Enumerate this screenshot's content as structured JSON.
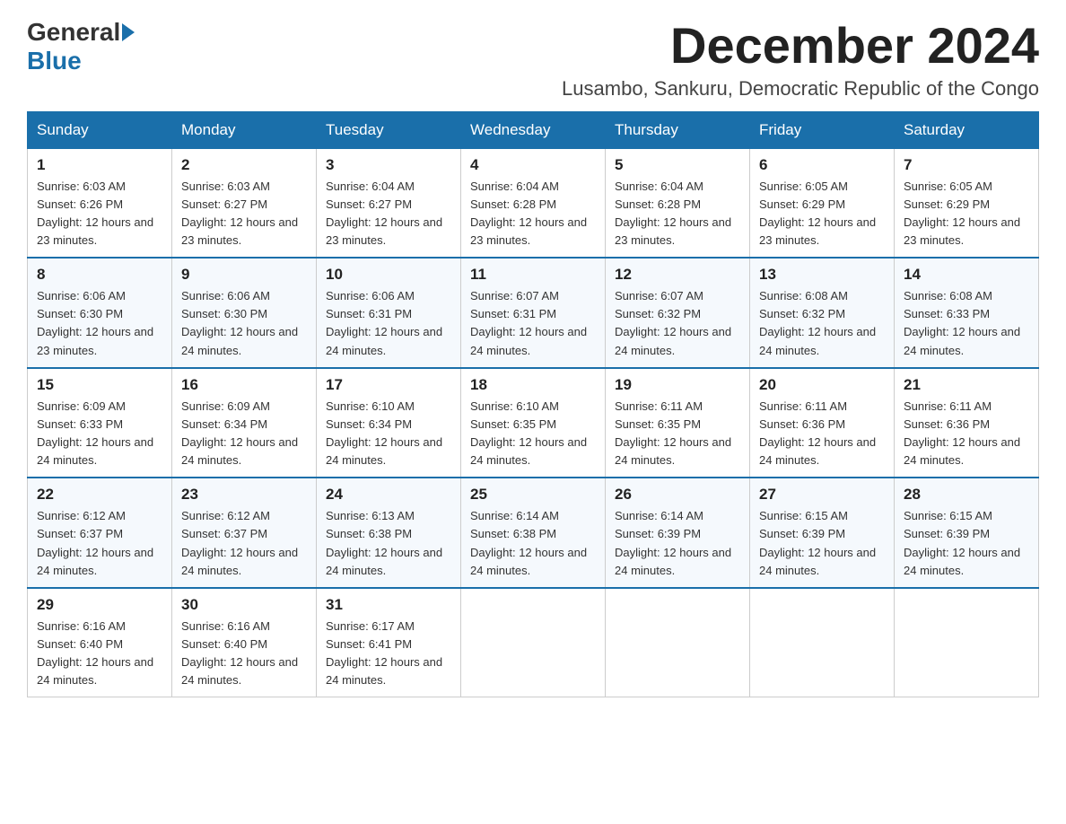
{
  "logo": {
    "general": "General",
    "blue": "Blue"
  },
  "title": "December 2024",
  "location": "Lusambo, Sankuru, Democratic Republic of the Congo",
  "headers": [
    "Sunday",
    "Monday",
    "Tuesday",
    "Wednesday",
    "Thursday",
    "Friday",
    "Saturday"
  ],
  "weeks": [
    [
      {
        "day": "1",
        "sunrise": "6:03 AM",
        "sunset": "6:26 PM",
        "daylight": "12 hours and 23 minutes."
      },
      {
        "day": "2",
        "sunrise": "6:03 AM",
        "sunset": "6:27 PM",
        "daylight": "12 hours and 23 minutes."
      },
      {
        "day": "3",
        "sunrise": "6:04 AM",
        "sunset": "6:27 PM",
        "daylight": "12 hours and 23 minutes."
      },
      {
        "day": "4",
        "sunrise": "6:04 AM",
        "sunset": "6:28 PM",
        "daylight": "12 hours and 23 minutes."
      },
      {
        "day": "5",
        "sunrise": "6:04 AM",
        "sunset": "6:28 PM",
        "daylight": "12 hours and 23 minutes."
      },
      {
        "day": "6",
        "sunrise": "6:05 AM",
        "sunset": "6:29 PM",
        "daylight": "12 hours and 23 minutes."
      },
      {
        "day": "7",
        "sunrise": "6:05 AM",
        "sunset": "6:29 PM",
        "daylight": "12 hours and 23 minutes."
      }
    ],
    [
      {
        "day": "8",
        "sunrise": "6:06 AM",
        "sunset": "6:30 PM",
        "daylight": "12 hours and 23 minutes."
      },
      {
        "day": "9",
        "sunrise": "6:06 AM",
        "sunset": "6:30 PM",
        "daylight": "12 hours and 24 minutes."
      },
      {
        "day": "10",
        "sunrise": "6:06 AM",
        "sunset": "6:31 PM",
        "daylight": "12 hours and 24 minutes."
      },
      {
        "day": "11",
        "sunrise": "6:07 AM",
        "sunset": "6:31 PM",
        "daylight": "12 hours and 24 minutes."
      },
      {
        "day": "12",
        "sunrise": "6:07 AM",
        "sunset": "6:32 PM",
        "daylight": "12 hours and 24 minutes."
      },
      {
        "day": "13",
        "sunrise": "6:08 AM",
        "sunset": "6:32 PM",
        "daylight": "12 hours and 24 minutes."
      },
      {
        "day": "14",
        "sunrise": "6:08 AM",
        "sunset": "6:33 PM",
        "daylight": "12 hours and 24 minutes."
      }
    ],
    [
      {
        "day": "15",
        "sunrise": "6:09 AM",
        "sunset": "6:33 PM",
        "daylight": "12 hours and 24 minutes."
      },
      {
        "day": "16",
        "sunrise": "6:09 AM",
        "sunset": "6:34 PM",
        "daylight": "12 hours and 24 minutes."
      },
      {
        "day": "17",
        "sunrise": "6:10 AM",
        "sunset": "6:34 PM",
        "daylight": "12 hours and 24 minutes."
      },
      {
        "day": "18",
        "sunrise": "6:10 AM",
        "sunset": "6:35 PM",
        "daylight": "12 hours and 24 minutes."
      },
      {
        "day": "19",
        "sunrise": "6:11 AM",
        "sunset": "6:35 PM",
        "daylight": "12 hours and 24 minutes."
      },
      {
        "day": "20",
        "sunrise": "6:11 AM",
        "sunset": "6:36 PM",
        "daylight": "12 hours and 24 minutes."
      },
      {
        "day": "21",
        "sunrise": "6:11 AM",
        "sunset": "6:36 PM",
        "daylight": "12 hours and 24 minutes."
      }
    ],
    [
      {
        "day": "22",
        "sunrise": "6:12 AM",
        "sunset": "6:37 PM",
        "daylight": "12 hours and 24 minutes."
      },
      {
        "day": "23",
        "sunrise": "6:12 AM",
        "sunset": "6:37 PM",
        "daylight": "12 hours and 24 minutes."
      },
      {
        "day": "24",
        "sunrise": "6:13 AM",
        "sunset": "6:38 PM",
        "daylight": "12 hours and 24 minutes."
      },
      {
        "day": "25",
        "sunrise": "6:14 AM",
        "sunset": "6:38 PM",
        "daylight": "12 hours and 24 minutes."
      },
      {
        "day": "26",
        "sunrise": "6:14 AM",
        "sunset": "6:39 PM",
        "daylight": "12 hours and 24 minutes."
      },
      {
        "day": "27",
        "sunrise": "6:15 AM",
        "sunset": "6:39 PM",
        "daylight": "12 hours and 24 minutes."
      },
      {
        "day": "28",
        "sunrise": "6:15 AM",
        "sunset": "6:39 PM",
        "daylight": "12 hours and 24 minutes."
      }
    ],
    [
      {
        "day": "29",
        "sunrise": "6:16 AM",
        "sunset": "6:40 PM",
        "daylight": "12 hours and 24 minutes."
      },
      {
        "day": "30",
        "sunrise": "6:16 AM",
        "sunset": "6:40 PM",
        "daylight": "12 hours and 24 minutes."
      },
      {
        "day": "31",
        "sunrise": "6:17 AM",
        "sunset": "6:41 PM",
        "daylight": "12 hours and 24 minutes."
      },
      null,
      null,
      null,
      null
    ]
  ]
}
